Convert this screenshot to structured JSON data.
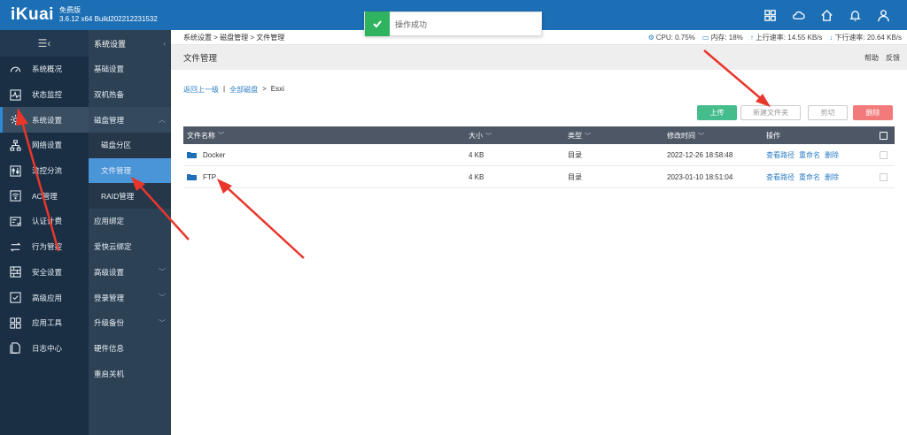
{
  "header": {
    "logo": "iKuai",
    "edition": "免费版",
    "version": "3.6.12 x64 Build202212231532",
    "icons": [
      "grid-icon",
      "cloud-icon",
      "home-icon",
      "bell-icon",
      "user-icon"
    ]
  },
  "toast": {
    "text": "操作成功",
    "color": "#2fb35f"
  },
  "sidebar": {
    "toggle_glyph": "☰‹",
    "items": [
      {
        "label": "系统概况",
        "icon": "dashboard-icon"
      },
      {
        "label": "状态监控",
        "icon": "monitor-icon"
      },
      {
        "label": "系统设置",
        "icon": "gear-icon"
      },
      {
        "label": "网络设置",
        "icon": "network-icon"
      },
      {
        "label": "流控分流",
        "icon": "sliders-icon"
      },
      {
        "label": "AC管理",
        "icon": "wifi-icon"
      },
      {
        "label": "认证计费",
        "icon": "auth-icon"
      },
      {
        "label": "行为管控",
        "icon": "arrows-icon"
      },
      {
        "label": "安全设置",
        "icon": "firewall-icon"
      },
      {
        "label": "高级应用",
        "icon": "advanced-icon"
      },
      {
        "label": "应用工具",
        "icon": "tools-icon"
      },
      {
        "label": "日志中心",
        "icon": "log-icon"
      }
    ]
  },
  "submenu": {
    "title": "系统设置",
    "items": [
      {
        "label": "基础设置"
      },
      {
        "label": "双机热备"
      },
      {
        "label": "磁盘管理",
        "chevron": "︿"
      },
      {
        "label": "磁盘分区"
      },
      {
        "label": "文件管理"
      },
      {
        "label": "RAID管理"
      },
      {
        "label": "应用绑定"
      },
      {
        "label": "爱快云绑定"
      },
      {
        "label": "高级设置",
        "chevron": "﹀"
      },
      {
        "label": "登录管理",
        "chevron": "﹀"
      },
      {
        "label": "升级备份",
        "chevron": "﹀"
      },
      {
        "label": "硬件信息"
      },
      {
        "label": "重启关机"
      }
    ]
  },
  "breadcrumb": "系统设置 > 磁盘管理 > 文件管理",
  "stats": {
    "cpu": "CPU: 0.75%",
    "mem": "内存: 18%",
    "up": "上行速率: 14.55 KB/s",
    "down": "下行速率: 20.64 KB/s"
  },
  "page": {
    "title": "文件管理",
    "help": "帮助",
    "feedback": "反馈"
  },
  "path": {
    "back": "返回上一级",
    "sep": "|",
    "root": "全部磁盘",
    "gt": ">",
    "current": "Esxi"
  },
  "buttons": {
    "upload": "上传",
    "new_folder": "新建文件夹",
    "cut": "剪切",
    "delete": "删除"
  },
  "table": {
    "headers": [
      "文件名称",
      "大小",
      "类型",
      "修改时间",
      "操作"
    ],
    "sort_glyph": "﹀",
    "rows": [
      {
        "name": "Docker",
        "size": "4 KB",
        "type": "目录",
        "time": "2022-12-26 18:58:48",
        "ops": [
          "查看路径",
          "重命名",
          "删除"
        ]
      },
      {
        "name": "FTP",
        "size": "4 KB",
        "type": "目录",
        "time": "2023-01-10 18:51:04",
        "ops": [
          "查看路径",
          "重命名",
          "删除"
        ]
      }
    ]
  }
}
